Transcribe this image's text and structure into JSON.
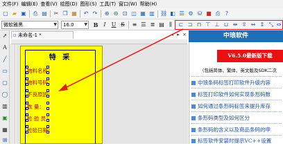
{
  "menubar": {
    "items": [
      "文件(F)",
      "编辑(E)",
      "查看(V)",
      "绘图(D)",
      "图形(S)",
      "工具(T)",
      "窗口(W)",
      "帮助(H)"
    ]
  },
  "font_toolbar": {
    "font_name": "微软雅黑",
    "font_size": "16.0",
    "bold": "B",
    "italic": "I",
    "underline": "U",
    "strikethrough": "S"
  },
  "document": {
    "tab_title": "未命名-1 *",
    "tab_close": "×"
  },
  "label": {
    "title": "特 采",
    "rows": [
      "物料名称：",
      "物料号码：",
      "不良原因：",
      "数     量：",
      "检 验 员：",
      "检验日期："
    ]
  },
  "right_panel": {
    "header": "中琅软件",
    "banner": "V6.5.0最新版下载",
    "subtitle": "（包括简体、繁体、英文版及SDK二次",
    "links": [
      "中琅条码标签打印软件升级内容",
      "标签打印软件如何实现条形码数",
      "如何通过条形码标签来提升库存",
      "条形码类型及如何区分",
      "条形码的含义以及商品条码的申",
      "标签软件安装时提示VC++设置"
    ]
  },
  "colors": {
    "label_background": "#ffff00",
    "label_text": "#c00000",
    "panel_header": "#1f6fb7",
    "banner": "#e81010",
    "annotation": "#e02020",
    "link": "#1a4fa0"
  },
  "icons": {
    "toolbar1": [
      "new-icon",
      "open-icon",
      "save-icon",
      "print-icon",
      "print-preview-icon",
      "cut-icon",
      "copy-icon",
      "paste-icon",
      "undo-icon",
      "redo-icon",
      "zoom-in-icon",
      "zoom-out-icon",
      "zoom-fit-icon",
      "grid-icon",
      "settings-icon",
      "database-icon"
    ],
    "left_tools": [
      "pointer-icon",
      "text-icon",
      "line-icon",
      "rectangle-icon",
      "ellipse-icon",
      "barcode-icon",
      "image-icon",
      "table-icon",
      "qrcode-icon"
    ]
  }
}
